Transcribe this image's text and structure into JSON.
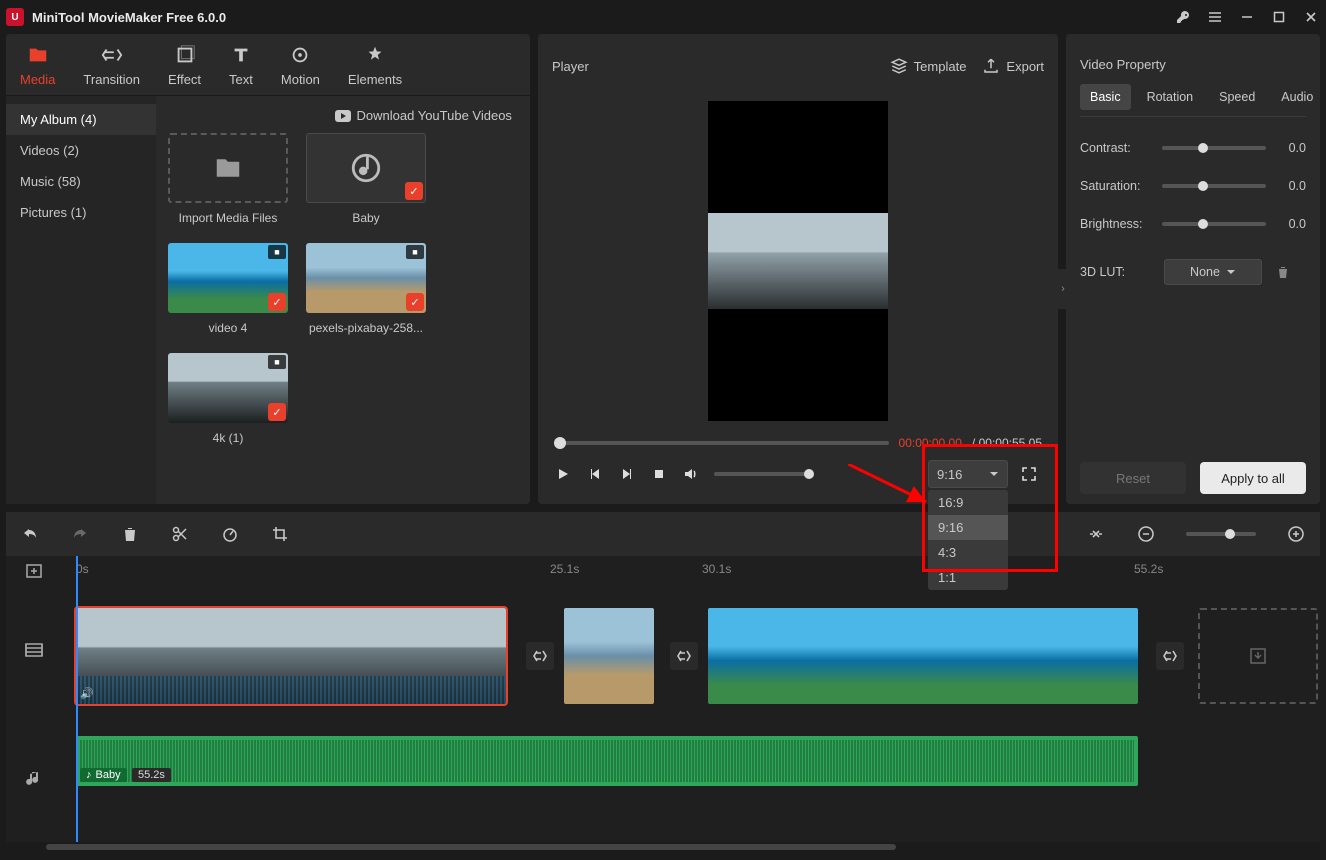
{
  "app": {
    "title": "MiniTool MovieMaker Free 6.0.0"
  },
  "toolbar": {
    "items": [
      {
        "label": "Media"
      },
      {
        "label": "Transition"
      },
      {
        "label": "Effect"
      },
      {
        "label": "Text"
      },
      {
        "label": "Motion"
      },
      {
        "label": "Elements"
      }
    ]
  },
  "album": {
    "nav": [
      "My Album (4)",
      "Videos (2)",
      "Music (58)",
      "Pictures (1)"
    ],
    "download_label": "Download YouTube Videos",
    "items": [
      {
        "label": "Import Media Files",
        "type": "import"
      },
      {
        "label": "Baby",
        "type": "audio",
        "checked": true
      },
      {
        "label": "video 4",
        "type": "video",
        "checked": true
      },
      {
        "label": "pexels-pixabay-258...",
        "type": "video",
        "checked": true
      },
      {
        "label": "4k (1)",
        "type": "video",
        "checked": true
      }
    ]
  },
  "player": {
    "title": "Player",
    "template_label": "Template",
    "export_label": "Export",
    "time_current": "00:00:00.00",
    "time_sep": " / ",
    "time_total": "00:00:55.05",
    "aspect": {
      "current": "9:16",
      "options": [
        "16:9",
        "9:16",
        "4:3",
        "1:1"
      ]
    }
  },
  "props": {
    "title": "Video Property",
    "tabs": [
      "Basic",
      "Rotation",
      "Speed",
      "Audio"
    ],
    "sliders": [
      {
        "label": "Contrast:",
        "value": "0.0"
      },
      {
        "label": "Saturation:",
        "value": "0.0"
      },
      {
        "label": "Brightness:",
        "value": "0.0"
      }
    ],
    "lut": {
      "label": "3D LUT:",
      "value": "None"
    },
    "reset": "Reset",
    "apply": "Apply to all"
  },
  "timeline": {
    "ruler": [
      "0s",
      "25.1s",
      "30.1s",
      "55.2s"
    ],
    "audio_clip": {
      "name": "Baby",
      "duration": "55.2s"
    }
  }
}
